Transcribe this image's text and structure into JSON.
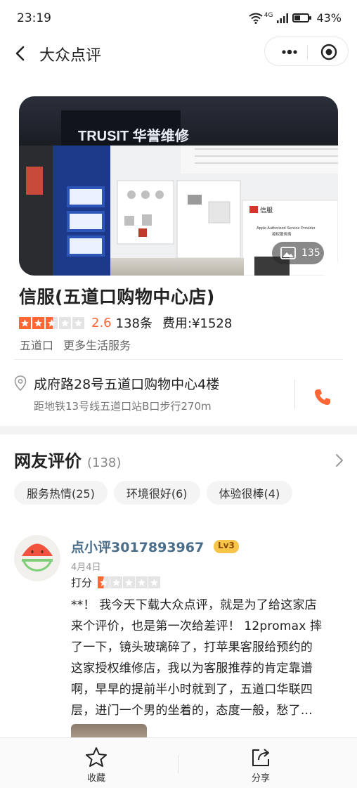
{
  "status": {
    "time": "23:19",
    "network": "4G",
    "battery": "43%",
    "battery_level": 0.43
  },
  "nav": {
    "back_icon": "chevron-left-icon",
    "title": "大众点评",
    "more_icon": "more-dots-icon",
    "close_icon": "target-icon"
  },
  "hero": {
    "photo_count": "135",
    "sign_text": "TRUSIT 华誉维修",
    "poster_brand": "信服",
    "poster_line1": "Apple Authorized Service Provider",
    "poster_line2": "授权服务商"
  },
  "shop": {
    "name": "信服(五道口购物中心店)",
    "rating": 2.6,
    "rating_text": "2.6",
    "review_count_text": "138条",
    "price_text": "费用:¥1528",
    "tags": [
      "五道口",
      "更多生活服务"
    ]
  },
  "address": {
    "line1": "成府路28号五道口购物中心4楼",
    "line2": "距地铁13号线五道口站B口步行270m",
    "phone_icon": "phone-icon"
  },
  "reviews": {
    "heading": "网友评价",
    "count_text": "(138)",
    "chips": [
      "服务热情(25)",
      "环境很好(6)",
      "体验很棒(4)"
    ],
    "items": [
      {
        "user": "点小评3017893967",
        "level": "Lv3",
        "date": "4月4日",
        "score_label": "打分",
        "score": 0.5,
        "text_lines": [
          "**！ 我今天下载大众点评，就是为了给这家店",
          "来个评价，也是第一次给差评！ 12promax 摔",
          "了一下，镜头玻璃碎了，打苹果客服给预约的",
          "这家授权维修店，我以为客服推荐的肯定靠谱",
          "啊，早早的提前半小时就到了，五道口华联四",
          "层，进门一个男的坐着的，态度一般，愁了…"
        ]
      }
    ]
  },
  "bottom": {
    "favorite_label": "收藏",
    "share_label": "分享"
  },
  "colors": {
    "accent": "#ff6633",
    "username": "#4a6d8a",
    "level_badge": "#f6c54a"
  }
}
